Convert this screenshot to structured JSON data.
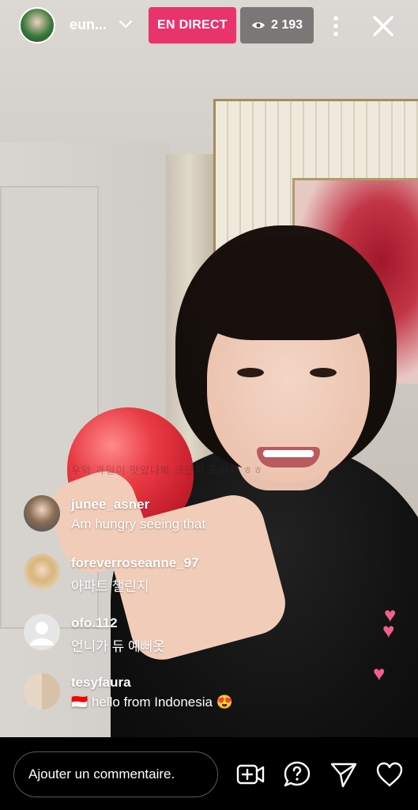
{
  "header": {
    "username": "eun...",
    "live_label": "EN DIRECT",
    "viewer_count": "2 193"
  },
  "video": {
    "caption": "우와 과일이 맛있나봐 크던지 오리가 ㅎㅎ"
  },
  "comments": [
    {
      "user": "junee_asner",
      "text": "Am hungry seeing that"
    },
    {
      "user": "foreverroseanne_97",
      "text": "아파트 챌린지"
    },
    {
      "user": "ofo.112",
      "text": "언니가 듀 예뻐옷"
    },
    {
      "user": "tesyfaura",
      "text": "🇮🇩 hello from Indonesia 😍"
    }
  ],
  "footer": {
    "comment_placeholder": "Ajouter un commentaire."
  },
  "colors": {
    "live_badge": "#e8336d",
    "heart": "#f06088"
  },
  "icons": {
    "header": [
      "chevron-down-icon",
      "eye-icon",
      "more-vertical-icon",
      "close-icon"
    ],
    "footer": [
      "add-video-icon",
      "question-icon",
      "send-icon",
      "heart-icon"
    ]
  }
}
